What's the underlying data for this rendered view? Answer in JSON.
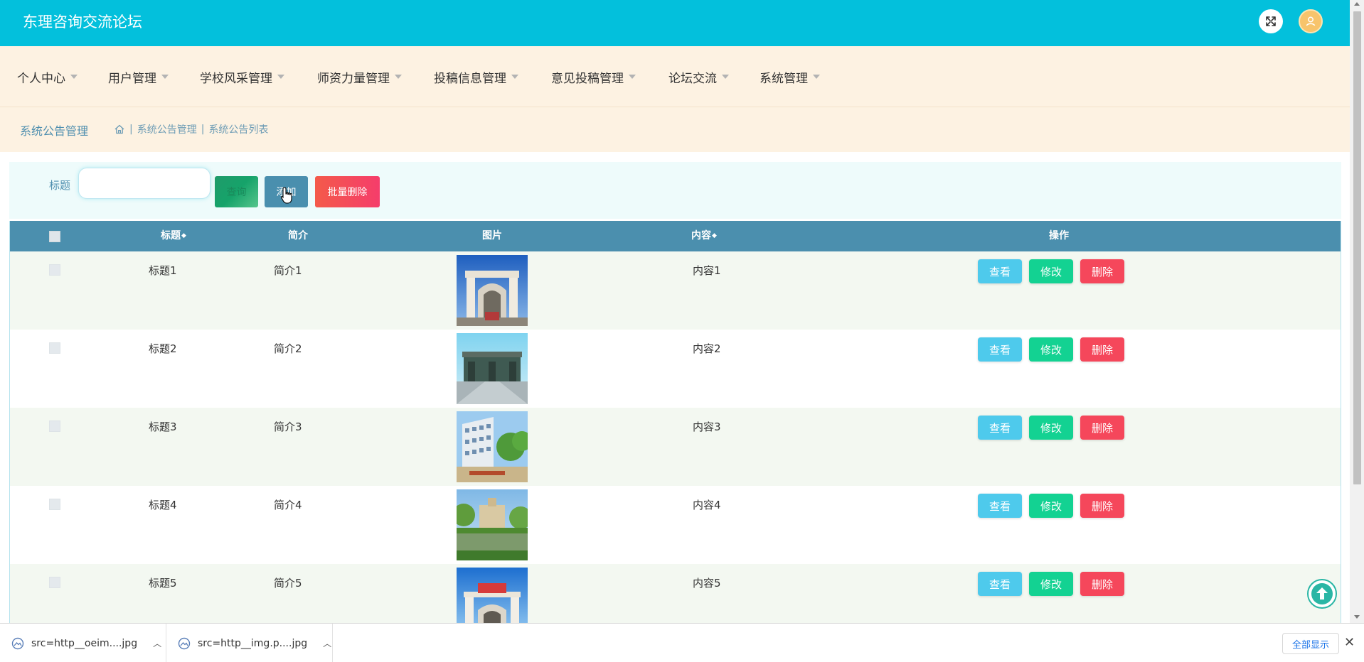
{
  "app": {
    "title": "东理咨询交流论坛"
  },
  "header": {
    "fullscreen_icon": "expand-icon",
    "user_icon": "user-avatar-icon"
  },
  "nav": {
    "items": [
      {
        "label": "个人中心"
      },
      {
        "label": "用户管理"
      },
      {
        "label": "学校风采管理"
      },
      {
        "label": "师资力量管理"
      },
      {
        "label": "投稿信息管理"
      },
      {
        "label": "意见投稿管理"
      },
      {
        "label": "论坛交流"
      },
      {
        "label": "系统管理"
      }
    ]
  },
  "breadcrumb": {
    "title": "系统公告管理",
    "home_icon": "home-icon",
    "items": [
      "系统公告管理",
      "系统公告列表"
    ]
  },
  "search": {
    "label": "标题",
    "value": "",
    "placeholder": "",
    "query_label": "查询",
    "add_label": "添加",
    "batch_delete_label": "批量删除"
  },
  "table": {
    "headers": {
      "title": "标题",
      "intro": "简介",
      "image": "图片",
      "content": "内容",
      "actions": "操作"
    },
    "actions": {
      "view": "查看",
      "edit": "修改",
      "delete": "删除"
    },
    "rows": [
      {
        "title": "标题1",
        "intro": "简介1",
        "content": "内容1"
      },
      {
        "title": "标题2",
        "intro": "简介2",
        "content": "内容2"
      },
      {
        "title": "标题3",
        "intro": "简介3",
        "content": "内容3"
      },
      {
        "title": "标题4",
        "intro": "简介4",
        "content": "内容4"
      },
      {
        "title": "标题5",
        "intro": "简介5",
        "content": "内容5"
      }
    ]
  },
  "downloads": {
    "items": [
      {
        "name": "src=http__oeim....jpg"
      },
      {
        "name": "src=http__img.p....jpg"
      }
    ],
    "show_all_label": "全部显示",
    "close_label": "✕"
  },
  "colors": {
    "header_bg": "#03c0dc",
    "nav_bg": "#fdf2e2",
    "table_head_bg": "#4b8fae",
    "view_btn": "#4ecaec",
    "edit_btn": "#13d292",
    "delete_btn": "#f5475b"
  }
}
